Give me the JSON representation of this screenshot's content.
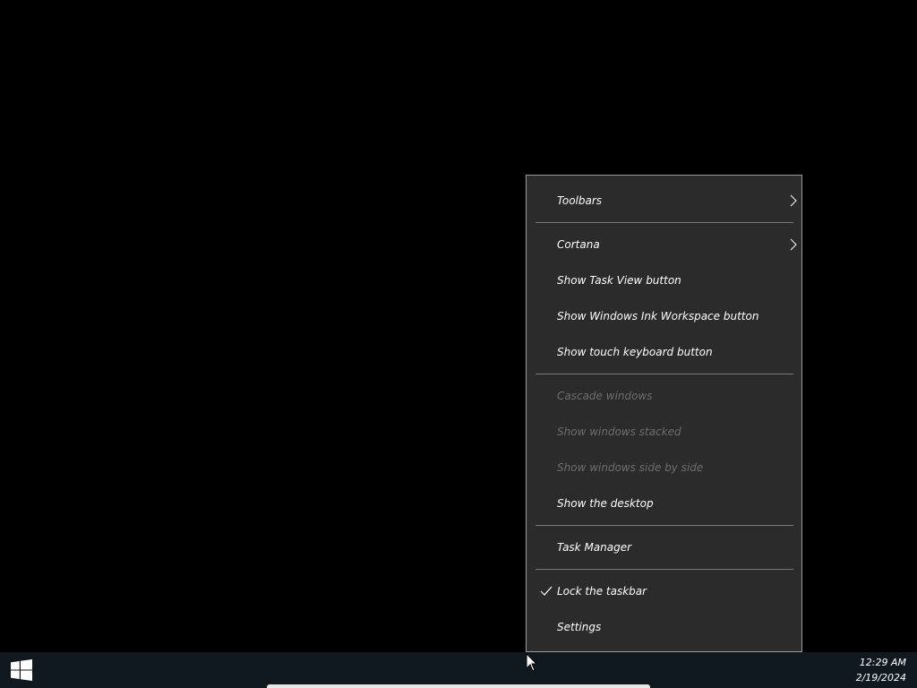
{
  "context_menu": {
    "items": [
      {
        "label": "Toolbars",
        "submenu": true,
        "enabled": true
      },
      {
        "label": "Cortana",
        "submenu": true,
        "enabled": true
      },
      {
        "label": "Show Task View button",
        "enabled": true
      },
      {
        "label": "Show Windows Ink Workspace button",
        "enabled": true
      },
      {
        "label": "Show touch keyboard button",
        "enabled": true
      },
      {
        "label": "Cascade windows",
        "enabled": false
      },
      {
        "label": "Show windows stacked",
        "enabled": false
      },
      {
        "label": "Show windows side by side",
        "enabled": false
      },
      {
        "label": "Show the desktop",
        "enabled": true
      },
      {
        "label": "Task Manager",
        "enabled": true
      },
      {
        "label": "Lock the taskbar",
        "enabled": true,
        "checked": true
      },
      {
        "label": "Settings",
        "enabled": true
      }
    ]
  },
  "taskbar": {
    "clock_time": "12:29 AM",
    "clock_date": "2/19/2024",
    "start_icon": "windows-logo-icon"
  },
  "colors": {
    "menu_bg": "#2b2b2b",
    "menu_border": "#9a9a9a",
    "taskbar_bg": "#101820",
    "text": "#ffffff",
    "disabled_text": "#6d6d6d"
  }
}
